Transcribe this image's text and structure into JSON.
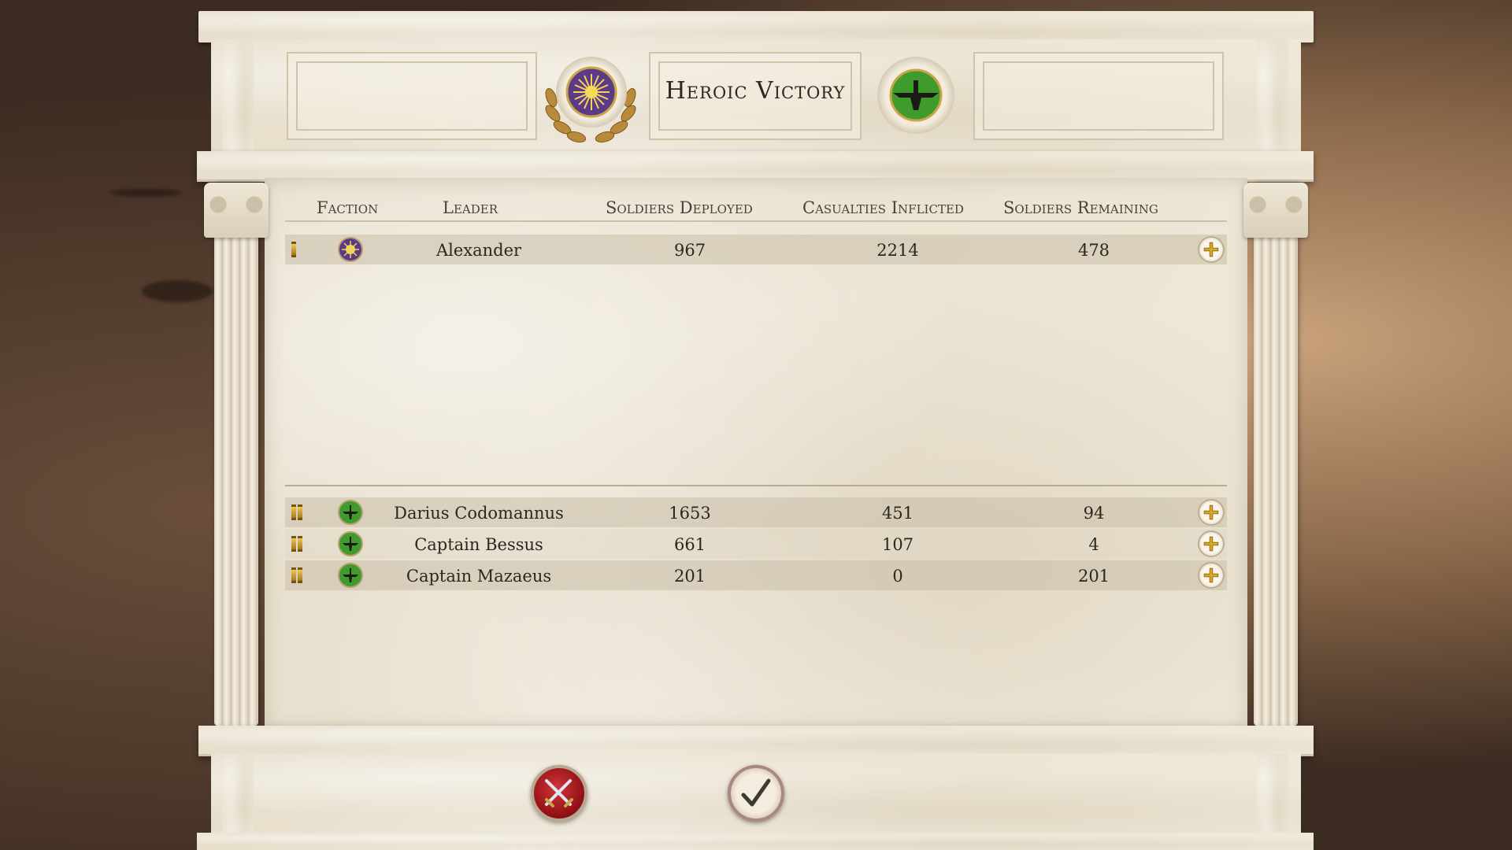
{
  "result": {
    "title": "Heroic Victory"
  },
  "table": {
    "headers": {
      "faction": "Faction",
      "leader": "Leader",
      "deployed": "Soldiers Deployed",
      "casualties": "Casualties Inflicted",
      "remaining": "Soldiers Remaining"
    },
    "victors": [
      {
        "rank": "I",
        "faction_icon": "macedon-sun-icon",
        "leader": "Alexander",
        "deployed": "967",
        "casualties": "2214",
        "remaining": "478"
      }
    ],
    "defeated": [
      {
        "rank": "II",
        "faction_icon": "persia-faravahar-icon",
        "leader": "Darius Codomannus",
        "deployed": "1653",
        "casualties": "451",
        "remaining": "94"
      },
      {
        "rank": "II",
        "faction_icon": "persia-faravahar-icon",
        "leader": "Captain Bessus",
        "deployed": "661",
        "casualties": "107",
        "remaining": "4"
      },
      {
        "rank": "II",
        "faction_icon": "persia-faravahar-icon",
        "leader": "Captain Mazaeus",
        "deployed": "201",
        "casualties": "0",
        "remaining": "201"
      }
    ]
  },
  "colors": {
    "macedon": "#5b3a86",
    "persia": "#3e9b2c",
    "gold": "#d9a92a",
    "cancel": "#b3262b"
  },
  "footer": {
    "cancel_icon": "crossed-swords-icon",
    "confirm_icon": "checkmark-icon"
  }
}
